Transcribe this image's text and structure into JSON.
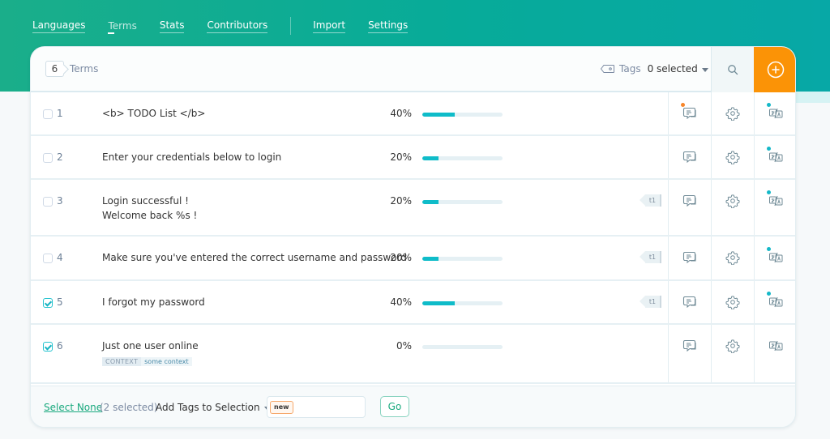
{
  "nav": {
    "items": [
      {
        "label": "Languages",
        "active": false
      },
      {
        "label": "Terms",
        "active": true
      },
      {
        "label": "Stats",
        "active": false
      },
      {
        "label": "Contributors",
        "active": false
      }
    ],
    "secondary": [
      {
        "label": "Import"
      },
      {
        "label": "Settings"
      }
    ]
  },
  "header": {
    "count": "6",
    "count_label": "Terms",
    "tags_label": "Tags",
    "tags_value": "0 selected",
    "search_icon": "search-icon",
    "add_icon": "plus-circle-icon"
  },
  "colors": {
    "brand": "#07ab99",
    "accent": "#fb9306",
    "progress": "#0fbcc9",
    "link": "#1aa97e"
  },
  "terms": [
    {
      "num": "1",
      "text": "<b> TODO List </b>",
      "line2": "",
      "checked": false,
      "percent": "40%",
      "progress": 0.4,
      "tag": "",
      "comment_dot": true,
      "translate_dot": true,
      "context_key": "",
      "context_value": ""
    },
    {
      "num": "2",
      "text": "Enter your credentials below to login",
      "line2": "",
      "checked": false,
      "percent": "20%",
      "progress": 0.2,
      "tag": "",
      "comment_dot": false,
      "translate_dot": true,
      "context_key": "",
      "context_value": ""
    },
    {
      "num": "3",
      "text": "Login successful !",
      "line2": "Welcome back %s !",
      "checked": false,
      "percent": "20%",
      "progress": 0.2,
      "tag": "t1",
      "comment_dot": false,
      "translate_dot": true,
      "context_key": "",
      "context_value": ""
    },
    {
      "num": "4",
      "text": "Make sure you've entered the correct username and password",
      "line2": "",
      "checked": false,
      "percent": "20%",
      "progress": 0.2,
      "tag": "t1",
      "comment_dot": false,
      "translate_dot": true,
      "context_key": "",
      "context_value": ""
    },
    {
      "num": "5",
      "text": "I forgot my password",
      "line2": "",
      "checked": true,
      "percent": "40%",
      "progress": 0.4,
      "tag": "t1",
      "comment_dot": false,
      "translate_dot": true,
      "context_key": "",
      "context_value": ""
    },
    {
      "num": "6",
      "text": "Just one user online",
      "line2": "",
      "checked": true,
      "percent": "0%",
      "progress": 0.0,
      "tag": "",
      "comment_dot": false,
      "translate_dot": false,
      "context_key": "CONTEXT",
      "context_value": "some context"
    }
  ],
  "footer": {
    "select_none": "Select None",
    "selected_count": "(2 selected)",
    "add_tags": "Add Tags to Selection",
    "new_chip": "new",
    "go": "Go"
  }
}
